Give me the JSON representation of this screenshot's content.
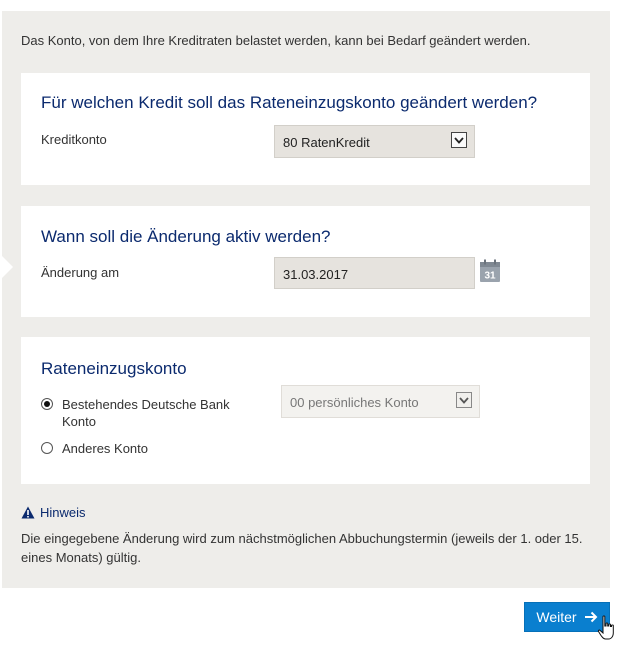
{
  "intro_text": "Das Konto, von dem Ihre Kreditraten belastet werden, kann bei Bedarf geändert werden.",
  "section_credit": {
    "title": "Für welchen Kredit soll das Rateneinzugskonto geändert werden?",
    "field_label": "Kreditkonto",
    "selected": "80 RatenKredit"
  },
  "section_date": {
    "title": "Wann soll die Änderung aktiv werden?",
    "field_label": "Änderung am",
    "value": "31.03.2017",
    "calendar_day": "31"
  },
  "section_account": {
    "title": "Rateneinzugskonto",
    "option_existing": "Bestehendes Deutsche Bank Konto",
    "option_other": "Anderes Konto",
    "existing_selected": true,
    "account_select": "00 persönliches Konto"
  },
  "hint": {
    "title": "Hinweis",
    "text": "Die eingegebene Änderung wird zum nächstmöglichen Abbuchungstermin (jeweils der 1. oder 15. eines Monats) gültig."
  },
  "button_next": "Weiter",
  "colors": {
    "heading": "#0b2a6e",
    "button": "#0a7fcf",
    "panel": "#eeedea"
  },
  "icons": {
    "dropdown": "chevron-down-icon",
    "calendar": "calendar-icon",
    "warning": "warning-triangle-icon",
    "next": "arrow-right-icon",
    "cursor": "hand-pointer-icon"
  }
}
